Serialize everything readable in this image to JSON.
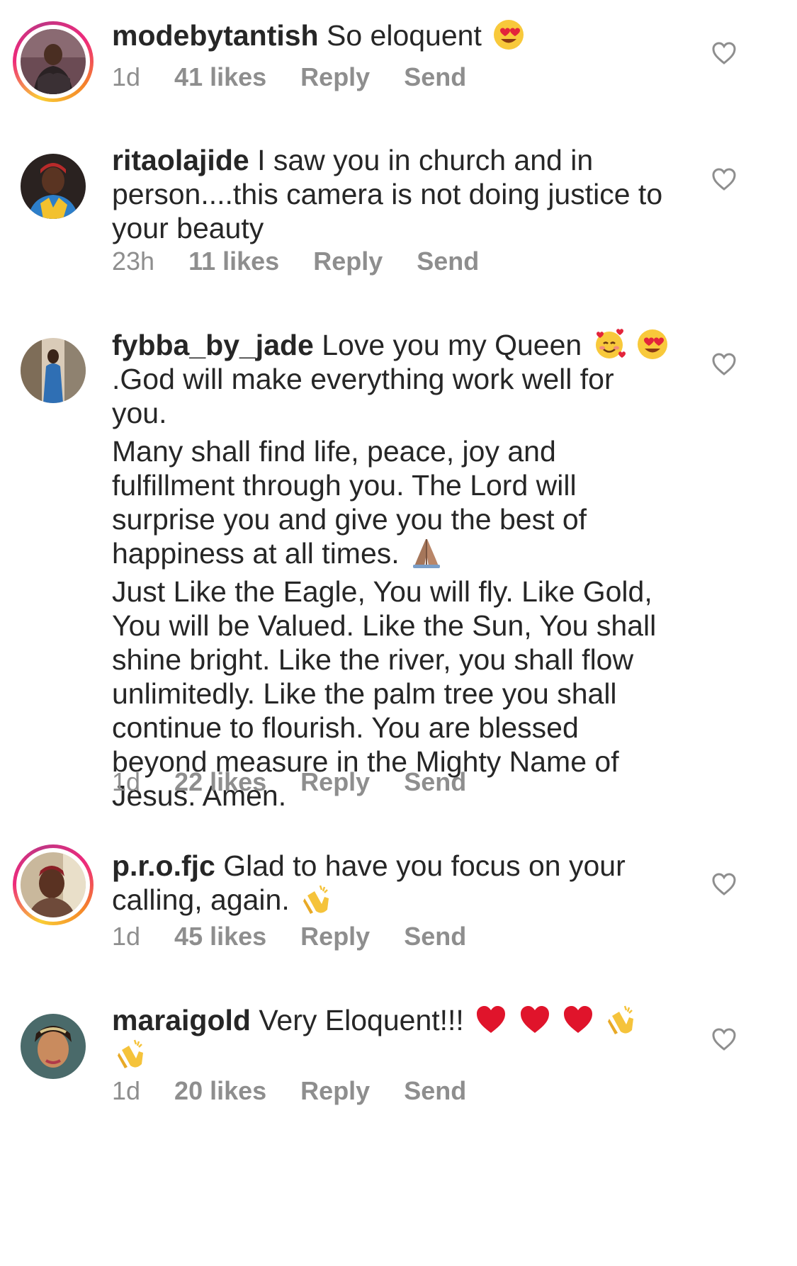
{
  "comments": [
    {
      "username": "modebytantish",
      "text": "So eloquent",
      "text_after_emoji": "",
      "paragraphs": [],
      "time": "1d",
      "likes": "41 likes",
      "reply": "Reply",
      "send": "Send",
      "has_story": true
    },
    {
      "username": "ritaolajide",
      "text": "I saw you in church and in person....this camera is not doing justice to your beauty",
      "time": "23h",
      "likes": "11 likes",
      "reply": "Reply",
      "send": "Send",
      "has_story": false
    },
    {
      "username": "fybba_by_jade",
      "text": "Love you my Queen",
      "text_after_emoji": ".God will make everything work well for you.",
      "paragraphs": [
        "Many shall find life, peace, joy and fulfillment through you. The Lord will surprise you and give you the best of happiness at all times.",
        "Just Like the Eagle, You will fly. Like Gold, You will be Valued. Like the Sun, You shall shine bright. Like the river, you shall flow unlimitedly. Like the palm tree you shall continue to flourish. You are blessed beyond measure in the Mighty Name of Jesus. Amen."
      ],
      "time": "1d",
      "likes": "22 likes",
      "reply": "Reply",
      "send": "Send",
      "has_story": false
    },
    {
      "username": "p.r.o.fjc",
      "text": "Glad to have you focus on your calling,  again.",
      "time": "1d",
      "likes": "45 likes",
      "reply": "Reply",
      "send": "Send",
      "has_story": true
    },
    {
      "username": "maraigold",
      "text": "Very Eloquent!!!",
      "time": "1d",
      "likes": "20 likes",
      "reply": "Reply",
      "send": "Send",
      "has_story": false
    }
  ],
  "icons": {
    "like": "heart-outline-icon",
    "emoji_heart_eyes": "heart-eyes-emoji",
    "emoji_smiling_hearts": "smiling-face-with-hearts-emoji",
    "emoji_pray": "folded-hands-emoji",
    "emoji_clap": "clapping-hands-emoji",
    "emoji_red_heart": "red-heart-emoji"
  },
  "colors": {
    "text": "#262626",
    "meta": "#8e8e8e",
    "story_ring_start": "#f9ce34",
    "story_ring_mid": "#ee2a7b",
    "story_ring_end": "#c13584"
  }
}
